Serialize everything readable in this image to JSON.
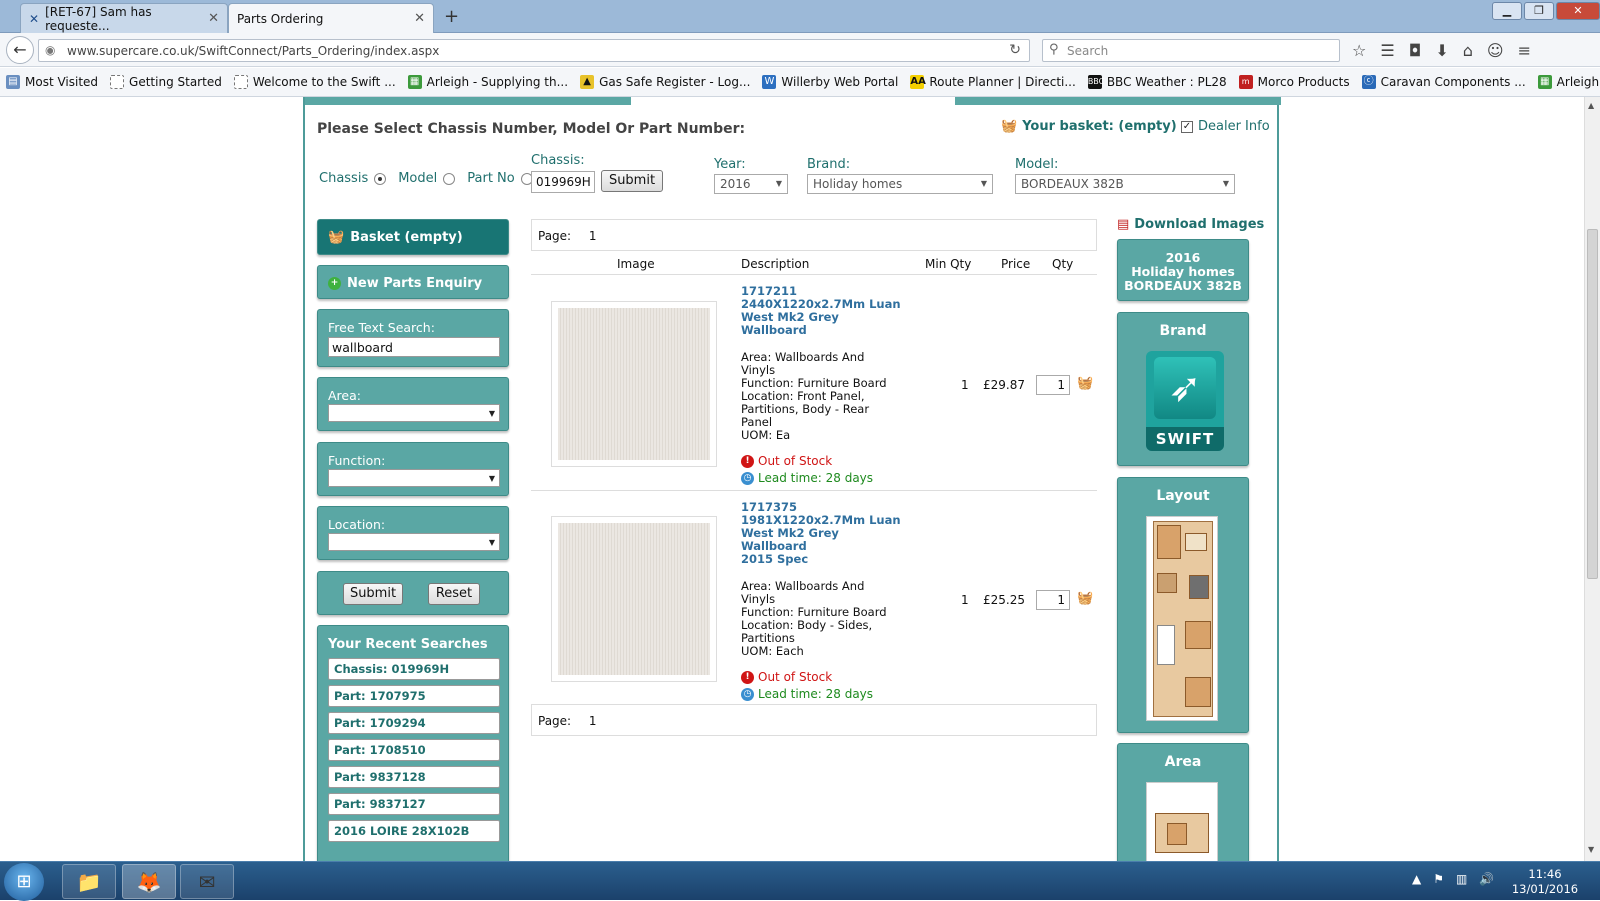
{
  "browser": {
    "tabs": [
      {
        "label": "[RET-67] Sam has requeste...",
        "active": false
      },
      {
        "label": "Parts Ordering",
        "active": true
      }
    ],
    "url": "www.supercare.co.uk/SwiftConnect/Parts_Ordering/index.aspx",
    "search_placeholder": "Search",
    "bookmarks": [
      "Most Visited",
      "Getting Started",
      "Welcome to the Swift ...",
      "Arleigh - Supplying th...",
      "Gas Safe Register - Log...",
      "Willerby Web Portal",
      "Route Planner | Directi...",
      "BBC Weather : PL28",
      "Morco Products",
      "Caravan Components ...",
      "Arleigh - Supplying th..."
    ]
  },
  "header": {
    "title": "Please Select Chassis Number, Model Or Part Number:",
    "basket": "Your basket: (empty)",
    "dealer_info": "Dealer Info"
  },
  "selector": {
    "radio_chassis": "Chassis",
    "radio_model": "Model",
    "radio_part": "Part No",
    "chassis_label": "Chassis:",
    "chassis_value": "019969H",
    "submit": "Submit",
    "year_label": "Year:",
    "year_value": "2016",
    "brand_label": "Brand:",
    "brand_value": "Holiday homes",
    "model_label": "Model:",
    "model_value": "BORDEAUX 382B"
  },
  "left": {
    "basket": "Basket (empty)",
    "new_enquiry": "New Parts Enquiry",
    "free_text_label": "Free Text Search:",
    "free_text_value": "wallboard",
    "area_label": "Area:",
    "function_label": "Function:",
    "location_label": "Location:",
    "submit": "Submit",
    "reset": "Reset",
    "recent_title": "Your Recent Searches",
    "recent": [
      "Chassis: 019969H",
      "Part: 1707975",
      "Part: 1709294",
      "Part: 1708510",
      "Part: 9837128",
      "Part: 9837127",
      "2016 LOIRE 28X102B"
    ]
  },
  "results": {
    "page_label": "Page:",
    "page_number": "1",
    "columns": [
      "Image",
      "Description",
      "Min Qty",
      "Price",
      "Qty"
    ],
    "items": [
      {
        "code": "1717211",
        "name_lines": [
          "2440X1220x2.7Mm Luan",
          "West Mk2 Grey",
          "Wallboard"
        ],
        "details": [
          "Area: Wallboards And",
          "Vinyls",
          "Function: Furniture Board",
          "Location: Front Panel,",
          "Partitions, Body - Rear",
          "Panel",
          "UOM: Ea"
        ],
        "stock": "Out of Stock",
        "lead": "Lead time: 28 days",
        "min_qty": "1",
        "price": "£29.87",
        "qty": "1"
      },
      {
        "code": "1717375",
        "name_lines": [
          "1981X1220x2.7Mm Luan",
          "West Mk2 Grey",
          "Wallboard",
          "2015 Spec"
        ],
        "details": [
          "Area: Wallboards And",
          "Vinyls",
          "Function: Furniture Board",
          "Location: Body - Sides,",
          "Partitions",
          "UOM: Each"
        ],
        "stock": "Out of Stock",
        "lead": "Lead time: 28 days",
        "min_qty": "1",
        "price": "£25.25",
        "qty": "1"
      }
    ]
  },
  "right": {
    "download": "Download Images",
    "summary_lines": [
      "2016",
      "Holiday homes",
      "BORDEAUX 382B"
    ],
    "brand_title": "Brand",
    "brand_logo": "SWIFT",
    "layout_title": "Layout",
    "area_title": "Area"
  },
  "taskbar": {
    "time": "11:46",
    "date": "13/01/2016"
  },
  "colors": {
    "teal": "#5aa7a4",
    "dark_teal": "#187574",
    "link_blue": "#2f6f9e",
    "out_of_stock": "#d01515",
    "lead_green": "#1e8a1e"
  }
}
